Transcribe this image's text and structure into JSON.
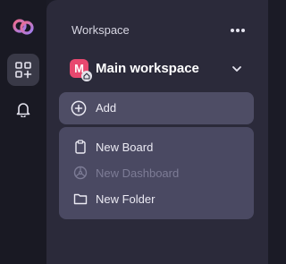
{
  "rail": {
    "items": [
      {
        "icon": "apps-add-icon",
        "active": true
      },
      {
        "icon": "bell-icon",
        "active": false
      }
    ]
  },
  "panel": {
    "title": "Workspace",
    "workspace": {
      "avatar_letter": "M",
      "name": "Main workspace",
      "avatar_color": "#e8486f"
    },
    "add_label": "Add",
    "menu": [
      {
        "label": "New Board",
        "icon": "clipboard-icon",
        "disabled": false
      },
      {
        "label": "New Dashboard",
        "icon": "dashboard-icon",
        "disabled": true
      },
      {
        "label": "New Folder",
        "icon": "folder-icon",
        "disabled": false
      }
    ]
  }
}
